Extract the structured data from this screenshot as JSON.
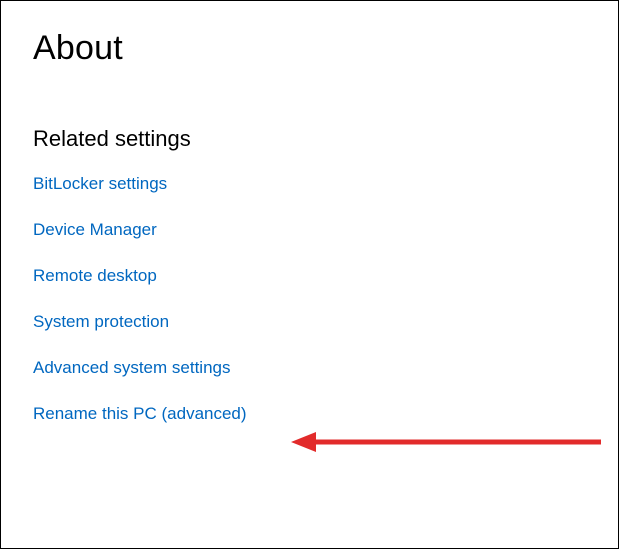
{
  "page": {
    "title": "About",
    "section_heading": "Related settings"
  },
  "links": {
    "bitlocker": "BitLocker settings",
    "device_manager": "Device Manager",
    "remote_desktop": "Remote desktop",
    "system_protection": "System protection",
    "advanced_system": "Advanced system settings",
    "rename_pc": "Rename this PC (advanced)"
  },
  "annotation": {
    "arrow_color": "#e22b2b"
  }
}
